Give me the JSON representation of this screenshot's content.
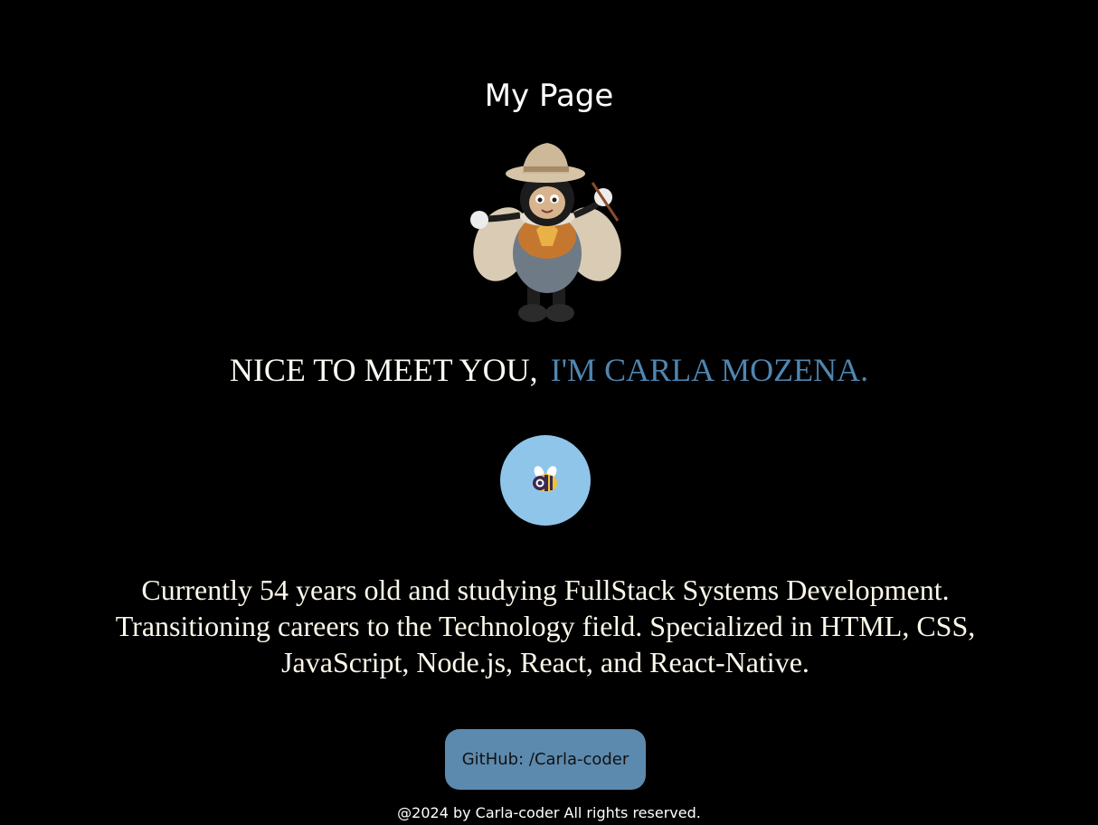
{
  "page": {
    "title": "My Page"
  },
  "mascot": {
    "icon": "bee-painter-illustration"
  },
  "greeting": {
    "part1": "NICE TO MEET YOU,",
    "part2": "I'M CARLA MOZENA.",
    "part1_color": "#fbfbf3",
    "part2_color": "#4f86b1"
  },
  "avatar": {
    "icon": "bee-icon",
    "background": "#90c5ea"
  },
  "bio": {
    "text": "Currently 54 years old and studying FullStack Systems Development. Transitioning careers to the Technology field. Specialized in HTML, CSS, JavaScript, Node.js, React, and React-Native."
  },
  "github": {
    "label": "GitHub: /Carla-coder",
    "background": "#5c8aae"
  },
  "footer": {
    "text": "@2024 by Carla-coder All rights reserved."
  }
}
